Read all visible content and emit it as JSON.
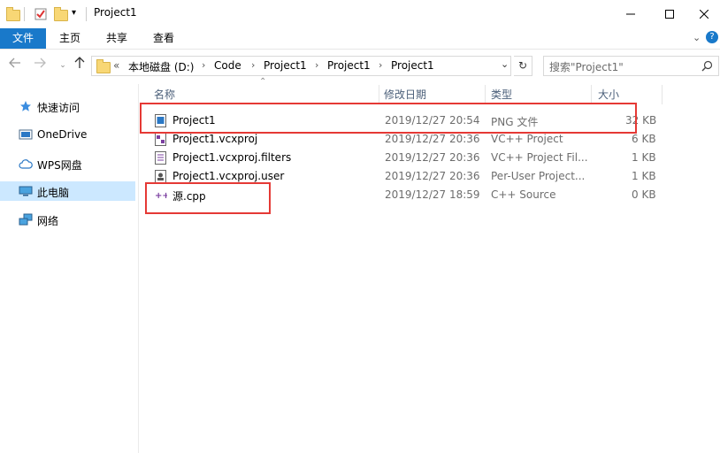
{
  "window": {
    "title": "Project1"
  },
  "ribbon": {
    "tabs": [
      "文件",
      "主页",
      "共享",
      "查看"
    ]
  },
  "address": {
    "overflow": "«",
    "crumbs": [
      "本地磁盘 (D:)",
      "Code",
      "Project1",
      "Project1",
      "Project1"
    ]
  },
  "search": {
    "placeholder": "搜索\"Project1\""
  },
  "nav": {
    "items": [
      "快速访问",
      "OneDrive",
      "WPS网盘",
      "此电脑",
      "网络"
    ],
    "selected": "此电脑"
  },
  "columns": {
    "name": "名称",
    "date": "修改日期",
    "type": "类型",
    "size": "大小"
  },
  "files": [
    {
      "name": "Project1",
      "date": "2019/12/27 20:54",
      "type": "PNG 文件",
      "size": "32 KB",
      "icon": "png-image-icon"
    },
    {
      "name": "Project1.vcxproj",
      "date": "2019/12/27 20:36",
      "type": "VC++ Project",
      "size": "6 KB",
      "icon": "vcxproj-icon"
    },
    {
      "name": "Project1.vcxproj.filters",
      "date": "2019/12/27 20:36",
      "type": "VC++ Project Fil...",
      "size": "1 KB",
      "icon": "filters-file-icon"
    },
    {
      "name": "Project1.vcxproj.user",
      "date": "2019/12/27 20:36",
      "type": "Per-User Project...",
      "size": "1 KB",
      "icon": "user-file-icon"
    },
    {
      "name": "源.cpp",
      "date": "2019/12/27 18:59",
      "type": "C++ Source",
      "size": "0 KB",
      "icon": "cpp-file-icon"
    }
  ],
  "colors": {
    "accent": "#1979ca",
    "selection": "#cce8ff",
    "highlight_box": "#e53935"
  }
}
